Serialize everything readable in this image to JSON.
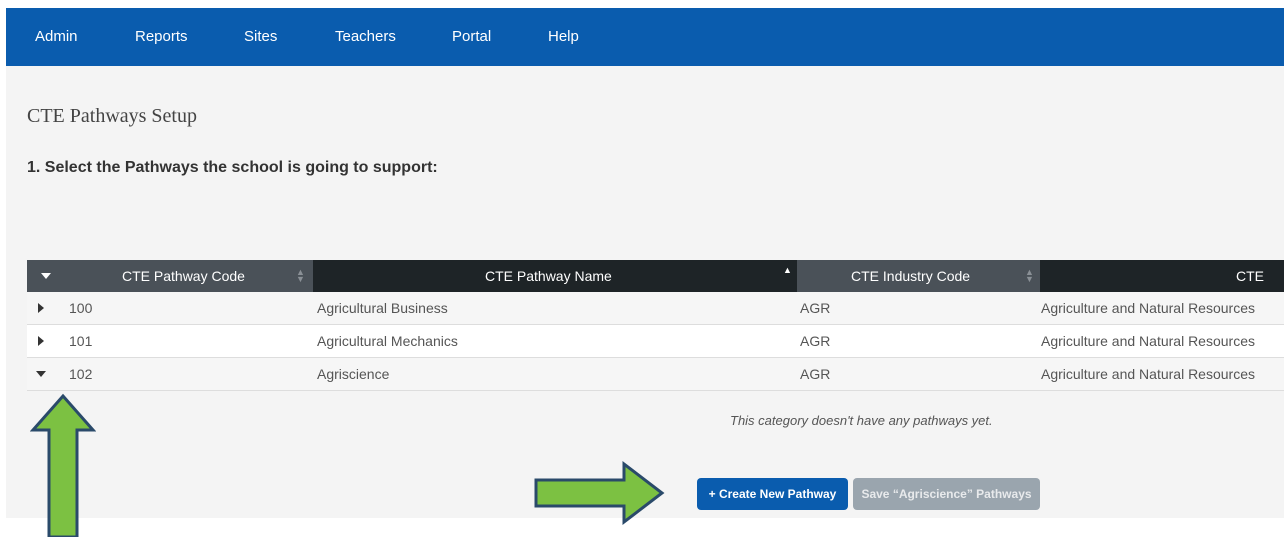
{
  "nav": {
    "items": [
      "Admin",
      "Reports",
      "Sites",
      "Teachers",
      "Portal",
      "Help"
    ]
  },
  "page": {
    "title": "CTE Pathways Setup",
    "instruction": "1. Select the Pathways the school is going to support:"
  },
  "table": {
    "columns": [
      "CTE Pathway Code",
      "CTE Pathway Name",
      "CTE Industry Code",
      "CTE Ind"
    ],
    "rows": [
      {
        "code": "100",
        "name": "Agricultural Business",
        "industry_code": "AGR",
        "industry": "Agriculture and Natural Resources",
        "expanded": false
      },
      {
        "code": "101",
        "name": "Agricultural Mechanics",
        "industry_code": "AGR",
        "industry": "Agriculture and Natural Resources",
        "expanded": false
      },
      {
        "code": "102",
        "name": "Agriscience",
        "industry_code": "AGR",
        "industry": "Agriculture and Natural Resources",
        "expanded": true
      }
    ],
    "empty_message": "This category doesn't have any pathways yet."
  },
  "buttons": {
    "create_label": "+ Create New Pathway",
    "save_label": "Save “Agriscience” Pathways"
  },
  "colors": {
    "nav_bg": "#0a5cae",
    "header_dark": "#1e2427",
    "header_gray": "#4a5158",
    "arrow_green": "#7cc142",
    "arrow_outline": "#2a4a6a"
  }
}
